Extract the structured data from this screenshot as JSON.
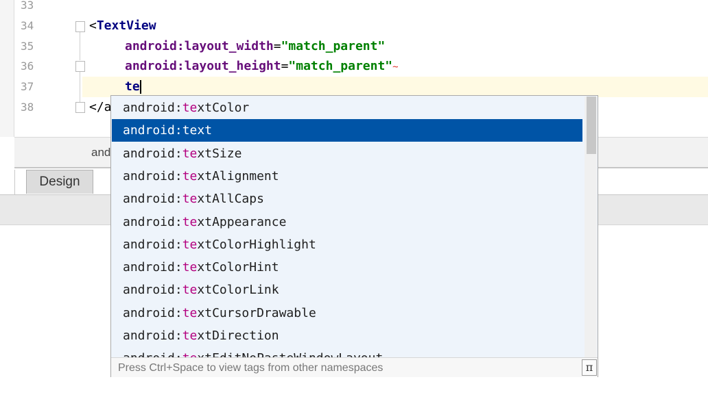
{
  "editor": {
    "lines": {
      "l33": {
        "num": "33"
      },
      "l34": {
        "num": "34",
        "open": "<",
        "tag": "TextView"
      },
      "l35": {
        "num": "35",
        "attr": "android:layout_width",
        "eq": "=",
        "val": "\"match_parent\""
      },
      "l36": {
        "num": "36",
        "attr": "android:layout_height",
        "eq": "=",
        "val": "\"match_parent\"",
        "warn": "~"
      },
      "l37": {
        "num": "37",
        "typed": "te"
      },
      "l38": {
        "num": "38",
        "partial": "</a"
      }
    }
  },
  "panel": {
    "strip_text": "and",
    "design_tab": "Design"
  },
  "completion": {
    "selected_index": 1,
    "items": [
      {
        "prefix": "android:",
        "match": "te",
        "rest": "xtColor"
      },
      {
        "prefix": "android:",
        "match": "te",
        "rest": "xt"
      },
      {
        "prefix": "android:",
        "match": "te",
        "rest": "xtSize"
      },
      {
        "prefix": "android:",
        "match": "te",
        "rest": "xtAlignment"
      },
      {
        "prefix": "android:",
        "match": "te",
        "rest": "xtAllCaps"
      },
      {
        "prefix": "android:",
        "match": "te",
        "rest": "xtAppearance"
      },
      {
        "prefix": "android:",
        "match": "te",
        "rest": "xtColorHighlight"
      },
      {
        "prefix": "android:",
        "match": "te",
        "rest": "xtColorHint"
      },
      {
        "prefix": "android:",
        "match": "te",
        "rest": "xtColorLink"
      },
      {
        "prefix": "android:",
        "match": "te",
        "rest": "xtCursorDrawable"
      },
      {
        "prefix": "android:",
        "match": "te",
        "rest": "xtDirection"
      },
      {
        "prefix": "android:",
        "match": "te",
        "rest": "xtEditNoPasteWindowLayout"
      }
    ],
    "footer": "Press Ctrl+Space to view tags from other namespaces",
    "pi_button": "π"
  },
  "colors": {
    "selection": "#0054a6",
    "match_highlight": "#b3007f",
    "tag": "#000080",
    "attribute": "#660e7a",
    "value": "#008000"
  }
}
